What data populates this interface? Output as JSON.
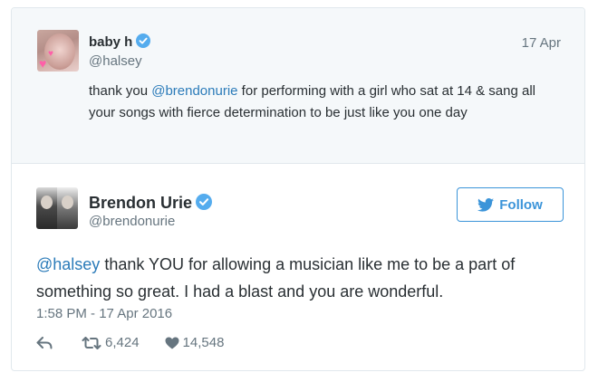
{
  "parent_tweet": {
    "display_name": "baby h",
    "handle": "@halsey",
    "date": "17 Apr",
    "text_before": "thank you ",
    "mention": "@brendonurie",
    "text_after": " for performing with a girl who sat at 14 & sang all your songs with fierce determination to be just like you one day"
  },
  "reply_tweet": {
    "display_name": "Brendon Urie",
    "handle": "@brendonurie",
    "follow_label": "Follow",
    "mention": "@halsey",
    "text_after": " thank YOU for allowing a musician like me to be a part of something so great. I had a blast and you are wonderful.",
    "timestamp": "1:58 PM - 17 Apr 2016",
    "retweets": "6,424",
    "likes": "14,548"
  },
  "icons": {
    "verified": "verified-badge-icon",
    "twitter_bird": "twitter-bird-icon",
    "reply": "reply-arrow-icon",
    "retweet": "retweet-icon",
    "like": "heart-icon"
  },
  "colors": {
    "accent": "#3b94d9",
    "mention": "#2b7bb9",
    "verified": "#55acee",
    "muted": "#66757f",
    "text": "#292f33",
    "parent_background": "#f5f8fa"
  }
}
